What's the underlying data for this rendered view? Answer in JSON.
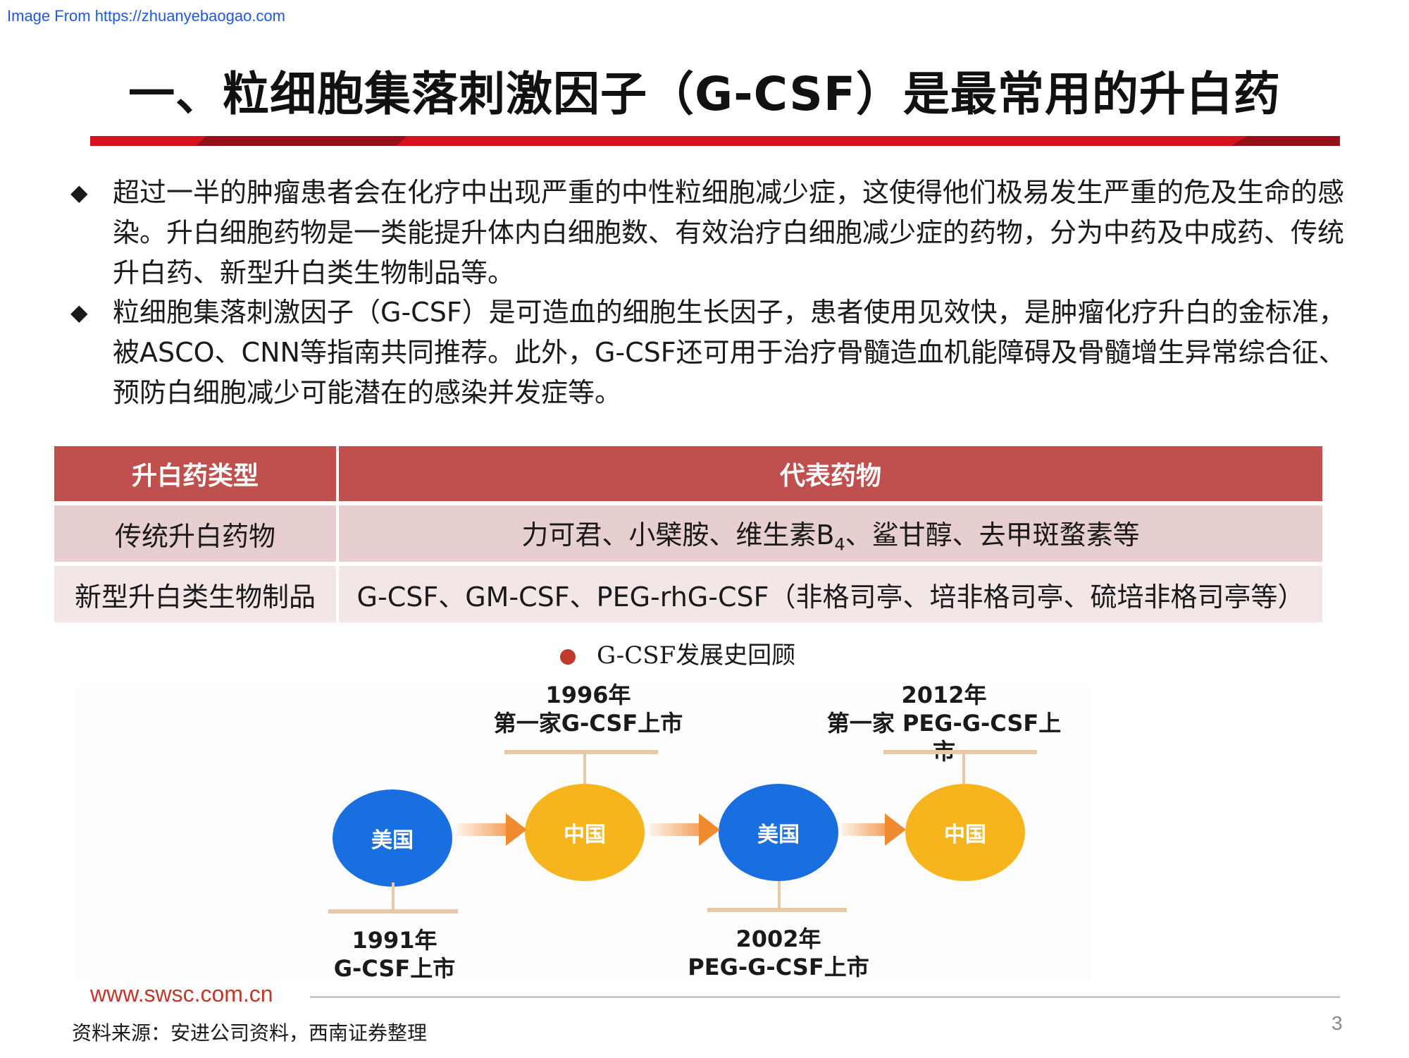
{
  "source_link": "Image From https://zhuanyebaogao.com",
  "title": "一、粒细胞集落刺激因子（G-CSF）是最常用的升白药",
  "bullets": [
    {
      "mark": "◆",
      "text": "超过一半的肿瘤患者会在化疗中出现严重的中性粒细胞减少症，这使得他们极易发生严重的危及生命的感染。升白细胞药物是一类能提升体内白细胞数、有效治疗白细胞减少症的药物，分为中药及中成药、传统升白药、新型升白类生物制品等。"
    },
    {
      "mark": "◆",
      "text": "粒细胞集落刺激因子（G-CSF）是可造血的细胞生长因子，患者使用见效快，是肿瘤化疗升白的金标准，被ASCO、CNN等指南共同推荐。此外，G-CSF还可用于治疗骨髓造血机能障碍及骨髓增生异常综合征、预防白细胞减少可能潜在的感染并发症等。"
    }
  ],
  "table": {
    "headers": [
      "升白药类型",
      "代表药物"
    ],
    "rows": [
      {
        "type": "传统升白药物",
        "drugs_pre": "力可君、小檗胺、维生素B",
        "drugs_sub": "4",
        "drugs_post": "、鲨甘醇、去甲斑蝥素等"
      },
      {
        "type": "新型升白类生物制品",
        "drugs": "G-CSF、GM-CSF、PEG-rhG-CSF（非格司亭、培非格司亭、硫培非格司亭等）"
      }
    ]
  },
  "timeline": {
    "title": "G-CSF发展史回顾",
    "nodes": [
      {
        "label": "美国",
        "color": "#1a6fe0"
      },
      {
        "label": "中国",
        "color": "#f6b51d"
      },
      {
        "label": "美国",
        "color": "#1a6fe0"
      },
      {
        "label": "中国",
        "color": "#f6b51d"
      }
    ],
    "events": [
      {
        "year": "1991年",
        "desc": "G-CSF上市"
      },
      {
        "year": "1996年",
        "desc": "第一家G-CSF上市"
      },
      {
        "year": "2002年",
        "desc": "PEG-G-CSF上市"
      },
      {
        "year": "2012年",
        "desc": "第一家 PEG-G-CSF上市"
      }
    ]
  },
  "footer": {
    "site": "www.swsc.com.cn",
    "source": "资料来源：安进公司资料，西南证券整理",
    "page": "3"
  },
  "colors": {
    "accent_red": "#d7101d",
    "table_header": "#c0504d",
    "blue": "#1a6fe0",
    "yellow": "#f6b51d",
    "arrow": "#f08a2e"
  }
}
